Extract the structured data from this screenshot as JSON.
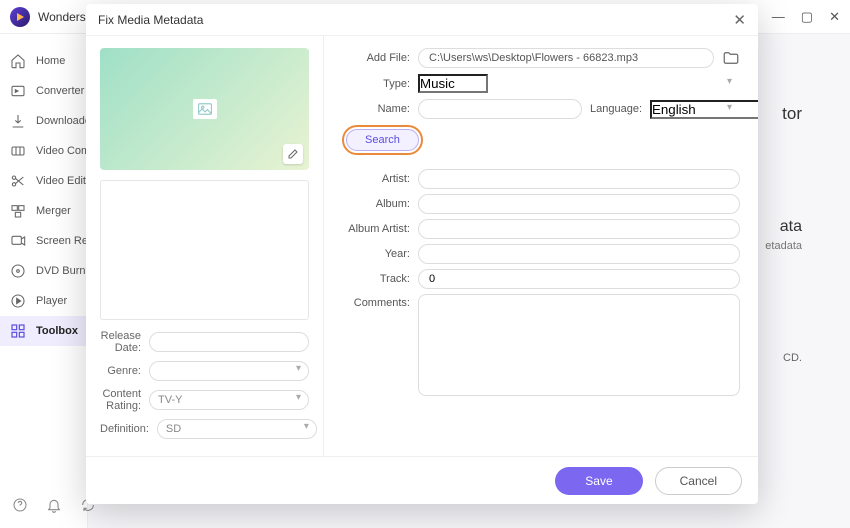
{
  "app": {
    "name": "Wondershare"
  },
  "window": {
    "min": "—",
    "max": "▢",
    "close": "✕"
  },
  "sidebar": {
    "items": [
      {
        "label": "Home"
      },
      {
        "label": "Converter"
      },
      {
        "label": "Downloader"
      },
      {
        "label": "Video Compressor"
      },
      {
        "label": "Video Editor"
      },
      {
        "label": "Merger"
      },
      {
        "label": "Screen Recorder"
      },
      {
        "label": "DVD Burner"
      },
      {
        "label": "Player"
      },
      {
        "label": "Toolbox"
      }
    ]
  },
  "background": {
    "text1": "tor",
    "text2": "ata",
    "text3": "etadata",
    "text4": "CD."
  },
  "modal": {
    "title": "Fix Media Metadata",
    "addfile_label": "Add File:",
    "addfile_value": "C:\\Users\\ws\\Desktop\\Flowers - 66823.mp3",
    "type_label": "Type:",
    "type_value": "Music",
    "name_label": "Name:",
    "name_value": "",
    "language_label": "Language:",
    "language_value": "English",
    "search_label": "Search",
    "fields": {
      "artist_label": "Artist:",
      "artist_value": "",
      "album_label": "Album:",
      "album_value": "",
      "albumartist_label": "Album Artist:",
      "albumartist_value": "",
      "year_label": "Year:",
      "year_value": "",
      "track_label": "Track:",
      "track_value": "0",
      "comments_label": "Comments:",
      "comments_value": ""
    },
    "left": {
      "release_label": "Release Date:",
      "release_value": "",
      "genre_label": "Genre:",
      "genre_value": "",
      "rating_label": "Content Rating:",
      "rating_value": "TV-Y",
      "definition_label": "Definition:",
      "definition_value": "SD"
    },
    "save": "Save",
    "cancel": "Cancel"
  }
}
